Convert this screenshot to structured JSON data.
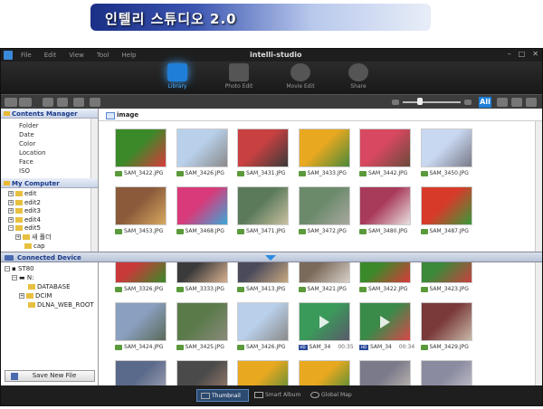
{
  "banner": {
    "title": "인텔리 스튜디오 2.0"
  },
  "app": {
    "title": "intelli-studio",
    "menu": [
      "File",
      "Edit",
      "View",
      "Tool",
      "Help"
    ]
  },
  "modes": [
    {
      "label": "Library",
      "active": true
    },
    {
      "label": "Photo Edit",
      "active": false
    },
    {
      "label": "Movie Edit",
      "active": false
    },
    {
      "label": "Share",
      "active": false
    }
  ],
  "toolbar": {
    "view_all_label": "All"
  },
  "contents_manager": {
    "header": "Contents Manager",
    "items": [
      "Folder",
      "Date",
      "Color",
      "Location",
      "Face",
      "ISO"
    ]
  },
  "my_computer": {
    "header": "My Computer",
    "items": [
      "edit",
      "edit2",
      "edit3",
      "edit4",
      "edit5",
      "새 폴더",
      "cap"
    ]
  },
  "library_path": "image",
  "top_thumbs": [
    {
      "name": "SAM_3422.JPG",
      "colors": [
        "#3a8a2a",
        "#d83a3a"
      ]
    },
    {
      "name": "SAM_3426.JPG",
      "colors": [
        "#b8d0ea",
        "#8a8a8a"
      ]
    },
    {
      "name": "SAM_3431.JPG",
      "colors": [
        "#c84040",
        "#3a3a3a"
      ]
    },
    {
      "name": "SAM_3433.JPG",
      "colors": [
        "#e8a820",
        "#4a8a3a"
      ]
    },
    {
      "name": "SAM_3442.JPG",
      "colors": [
        "#d84860",
        "#6a4a3a"
      ]
    },
    {
      "name": "SAM_3450.JPG",
      "colors": [
        "#c8d8f0",
        "#7a7a8a"
      ]
    },
    {
      "name": "SAM_3453.JPG",
      "colors": [
        "#8a5a3a",
        "#d8a860"
      ]
    },
    {
      "name": "SAM_3468.JPG",
      "colors": [
        "#d83a7a",
        "#3aa8d8"
      ]
    },
    {
      "name": "SAM_3471.JPG",
      "colors": [
        "#5a7a5a",
        "#c8c0a0"
      ]
    },
    {
      "name": "SAM_3472.JPG",
      "colors": [
        "#6a8a6a",
        "#a8a8a0"
      ]
    },
    {
      "name": "SAM_3480.JPG",
      "colors": [
        "#a83a5a",
        "#e8e0e0"
      ]
    },
    {
      "name": "SAM_3487.JPG",
      "colors": [
        "#d83a2a",
        "#3a9a3a"
      ]
    }
  ],
  "connected_device": {
    "header": "Connected Device",
    "tree": [
      "ST80",
      "N:",
      "DATABASE",
      "DCIM",
      "DLNA_WEB_ROOT"
    ],
    "save_label": "Save New File"
  },
  "bottom_thumbs": [
    {
      "name": "SAM_3326.JPG",
      "colors": [
        "#c83a3a",
        "#3a8a2a"
      ],
      "video": false,
      "duration": ""
    },
    {
      "name": "SAM_3333.JPG",
      "colors": [
        "#3a3a3a",
        "#d8b090"
      ],
      "video": false,
      "duration": ""
    },
    {
      "name": "SAM_3413.JPG",
      "colors": [
        "#4a4a5a",
        "#c8a880"
      ],
      "video": false,
      "duration": ""
    },
    {
      "name": "SAM_3421.JPG",
      "colors": [
        "#7a6a5a",
        "#d8d0c8"
      ],
      "video": false,
      "duration": ""
    },
    {
      "name": "SAM_3422.JPG",
      "colors": [
        "#3a8a2a",
        "#d83a3a"
      ],
      "video": false,
      "duration": ""
    },
    {
      "name": "SAM_3423.JPG",
      "colors": [
        "#3a8a3a",
        "#c84040"
      ],
      "video": false,
      "duration": ""
    },
    {
      "name": "SAM_3424.JPG",
      "colors": [
        "#8aa0c0",
        "#5a6a5a"
      ],
      "video": false,
      "duration": ""
    },
    {
      "name": "SAM_3425.JPG",
      "colors": [
        "#5a7a4a",
        "#8a8a7a"
      ],
      "video": false,
      "duration": ""
    },
    {
      "name": "SAM_3426.JPG",
      "colors": [
        "#b8d0ea",
        "#8a8a8a"
      ],
      "video": false,
      "duration": ""
    },
    {
      "name": "SAM_34",
      "colors": [
        "#3a9a5a",
        "#5a5a6a"
      ],
      "video": true,
      "duration": "00:35"
    },
    {
      "name": "SAM_34",
      "colors": [
        "#3a8a4a",
        "#d84848"
      ],
      "video": true,
      "duration": "00:34"
    },
    {
      "name": "SAM_3429.JPG",
      "colors": [
        "#7a3a3a",
        "#c8b8a8"
      ],
      "video": false,
      "duration": ""
    },
    {
      "name": "",
      "colors": [
        "#5a6a8a",
        "#a8a8b8"
      ],
      "video": false,
      "duration": ""
    },
    {
      "name": "",
      "colors": [
        "#4a4a4a",
        "#a08070"
      ],
      "video": false,
      "duration": ""
    },
    {
      "name": "",
      "colors": [
        "#e8a820",
        "#4a8a3a"
      ],
      "video": false,
      "duration": ""
    },
    {
      "name": "",
      "colors": [
        "#e8a820",
        "#3a8a3a"
      ],
      "video": false,
      "duration": ""
    },
    {
      "name": "",
      "colors": [
        "#7a7a8a",
        "#c8c0b8"
      ],
      "video": false,
      "duration": ""
    },
    {
      "name": "",
      "colors": [
        "#8a8aa0",
        "#c8c8d0"
      ],
      "video": false,
      "duration": ""
    }
  ],
  "bottom_tabs": [
    {
      "label": "Thumbnail",
      "active": true
    },
    {
      "label": "Smart Album",
      "active": false
    },
    {
      "label": "Global Map",
      "active": false
    }
  ]
}
